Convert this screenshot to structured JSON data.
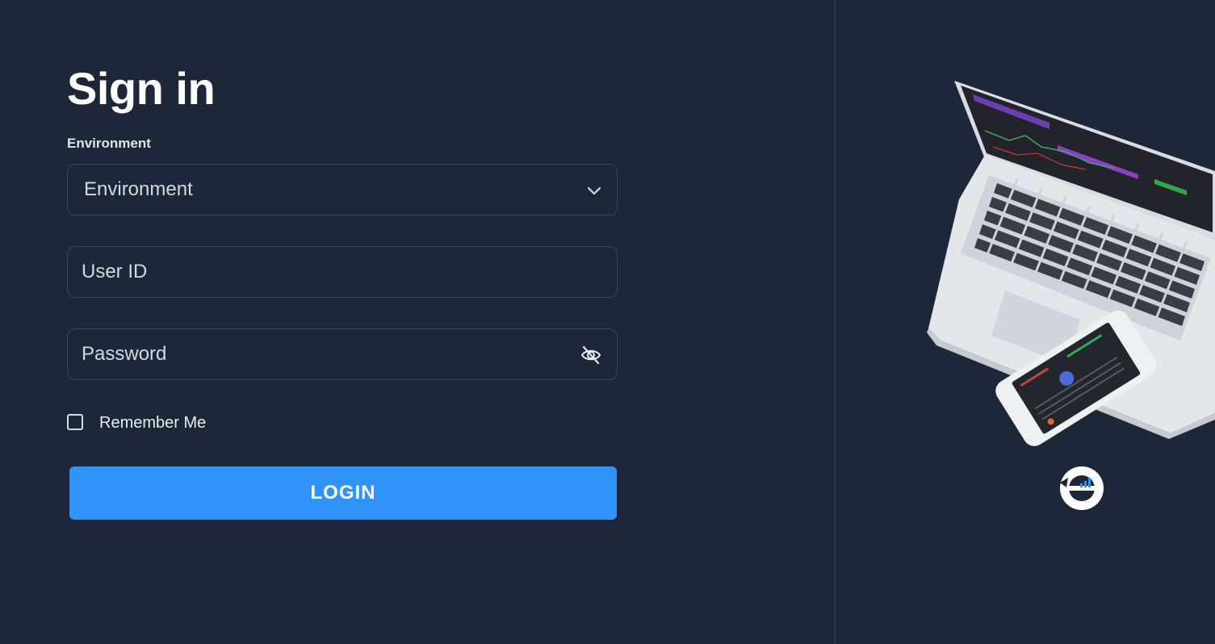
{
  "signin": {
    "title": "Sign in",
    "environment_label": "Environment",
    "environment_value": "Environment",
    "userid_placeholder": "User ID",
    "password_placeholder": "Password",
    "remember_me_label": "Remember Me",
    "login_label": "LOGIN"
  },
  "icons": {
    "select_chevron": "chevron-down-icon",
    "password_toggle": "eye-off-icon",
    "logo": "brand-logo"
  },
  "colors": {
    "background": "#1e2739",
    "accent": "#2f93f7",
    "border": "#3b4558"
  }
}
